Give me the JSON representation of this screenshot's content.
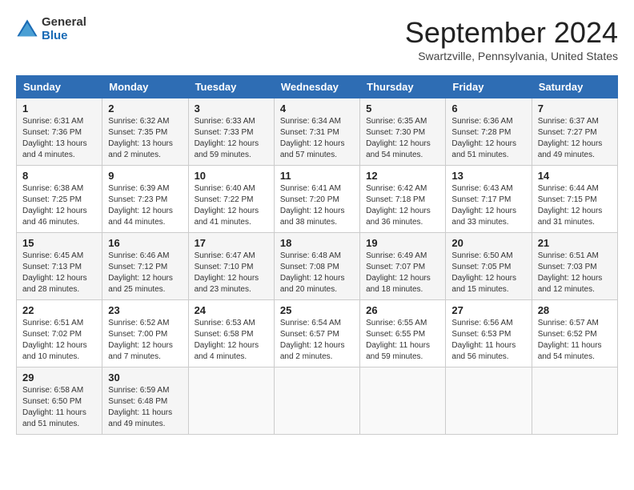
{
  "header": {
    "logo": {
      "general": "General",
      "blue": "Blue"
    },
    "title": "September 2024",
    "subtitle": "Swartzville, Pennsylvania, United States"
  },
  "weekdays": [
    "Sunday",
    "Monday",
    "Tuesday",
    "Wednesday",
    "Thursday",
    "Friday",
    "Saturday"
  ],
  "weeks": [
    [
      {
        "day": "1",
        "rise": "6:31 AM",
        "set": "7:36 PM",
        "daylight": "13 hours and 4 minutes"
      },
      {
        "day": "2",
        "rise": "6:32 AM",
        "set": "7:35 PM",
        "daylight": "13 hours and 2 minutes"
      },
      {
        "day": "3",
        "rise": "6:33 AM",
        "set": "7:33 PM",
        "daylight": "12 hours and 59 minutes"
      },
      {
        "day": "4",
        "rise": "6:34 AM",
        "set": "7:31 PM",
        "daylight": "12 hours and 57 minutes"
      },
      {
        "day": "5",
        "rise": "6:35 AM",
        "set": "7:30 PM",
        "daylight": "12 hours and 54 minutes"
      },
      {
        "day": "6",
        "rise": "6:36 AM",
        "set": "7:28 PM",
        "daylight": "12 hours and 51 minutes"
      },
      {
        "day": "7",
        "rise": "6:37 AM",
        "set": "7:27 PM",
        "daylight": "12 hours and 49 minutes"
      }
    ],
    [
      {
        "day": "8",
        "rise": "6:38 AM",
        "set": "7:25 PM",
        "daylight": "12 hours and 46 minutes"
      },
      {
        "day": "9",
        "rise": "6:39 AM",
        "set": "7:23 PM",
        "daylight": "12 hours and 44 minutes"
      },
      {
        "day": "10",
        "rise": "6:40 AM",
        "set": "7:22 PM",
        "daylight": "12 hours and 41 minutes"
      },
      {
        "day": "11",
        "rise": "6:41 AM",
        "set": "7:20 PM",
        "daylight": "12 hours and 38 minutes"
      },
      {
        "day": "12",
        "rise": "6:42 AM",
        "set": "7:18 PM",
        "daylight": "12 hours and 36 minutes"
      },
      {
        "day": "13",
        "rise": "6:43 AM",
        "set": "7:17 PM",
        "daylight": "12 hours and 33 minutes"
      },
      {
        "day": "14",
        "rise": "6:44 AM",
        "set": "7:15 PM",
        "daylight": "12 hours and 31 minutes"
      }
    ],
    [
      {
        "day": "15",
        "rise": "6:45 AM",
        "set": "7:13 PM",
        "daylight": "12 hours and 28 minutes"
      },
      {
        "day": "16",
        "rise": "6:46 AM",
        "set": "7:12 PM",
        "daylight": "12 hours and 25 minutes"
      },
      {
        "day": "17",
        "rise": "6:47 AM",
        "set": "7:10 PM",
        "daylight": "12 hours and 23 minutes"
      },
      {
        "day": "18",
        "rise": "6:48 AM",
        "set": "7:08 PM",
        "daylight": "12 hours and 20 minutes"
      },
      {
        "day": "19",
        "rise": "6:49 AM",
        "set": "7:07 PM",
        "daylight": "12 hours and 18 minutes"
      },
      {
        "day": "20",
        "rise": "6:50 AM",
        "set": "7:05 PM",
        "daylight": "12 hours and 15 minutes"
      },
      {
        "day": "21",
        "rise": "6:51 AM",
        "set": "7:03 PM",
        "daylight": "12 hours and 12 minutes"
      }
    ],
    [
      {
        "day": "22",
        "rise": "6:51 AM",
        "set": "7:02 PM",
        "daylight": "12 hours and 10 minutes"
      },
      {
        "day": "23",
        "rise": "6:52 AM",
        "set": "7:00 PM",
        "daylight": "12 hours and 7 minutes"
      },
      {
        "day": "24",
        "rise": "6:53 AM",
        "set": "6:58 PM",
        "daylight": "12 hours and 4 minutes"
      },
      {
        "day": "25",
        "rise": "6:54 AM",
        "set": "6:57 PM",
        "daylight": "12 hours and 2 minutes"
      },
      {
        "day": "26",
        "rise": "6:55 AM",
        "set": "6:55 PM",
        "daylight": "11 hours and 59 minutes"
      },
      {
        "day": "27",
        "rise": "6:56 AM",
        "set": "6:53 PM",
        "daylight": "11 hours and 56 minutes"
      },
      {
        "day": "28",
        "rise": "6:57 AM",
        "set": "6:52 PM",
        "daylight": "11 hours and 54 minutes"
      }
    ],
    [
      {
        "day": "29",
        "rise": "6:58 AM",
        "set": "6:50 PM",
        "daylight": "11 hours and 51 minutes"
      },
      {
        "day": "30",
        "rise": "6:59 AM",
        "set": "6:48 PM",
        "daylight": "11 hours and 49 minutes"
      },
      null,
      null,
      null,
      null,
      null
    ]
  ]
}
